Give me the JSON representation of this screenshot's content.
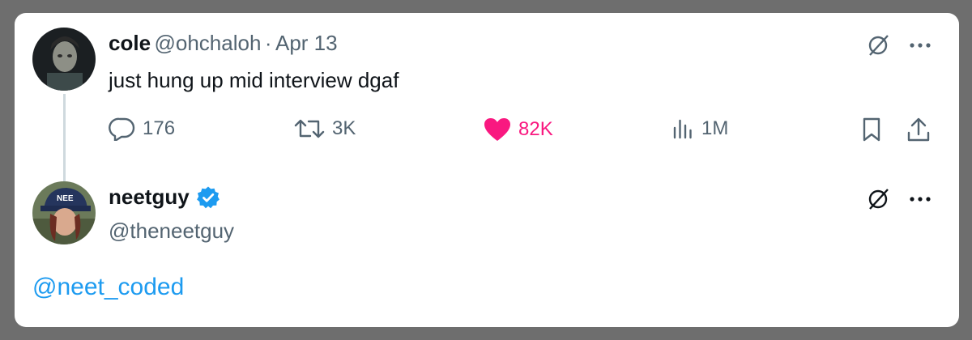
{
  "tweet": {
    "author_name": "cole",
    "author_handle": "@ohchaloh",
    "separator": "·",
    "date": "Apr 13",
    "text": "just hung up mid interview dgaf",
    "replies": "176",
    "retweets": "3K",
    "likes": "82K",
    "views": "1M",
    "liked": true
  },
  "reply": {
    "author_name": "neetguy",
    "author_handle": "@theneetguy",
    "verified": true,
    "text": "@neet_coded"
  },
  "icons": {
    "grok": "grok-icon",
    "more": "more-icon",
    "reply": "reply-icon",
    "retweet": "retweet-icon",
    "like": "heart-icon",
    "views": "views-icon",
    "bookmark": "bookmark-icon",
    "share": "share-icon",
    "verified": "verified-badge-icon"
  },
  "colors": {
    "like": "#f91880",
    "link": "#1d9bf0",
    "verified": "#1d9bf0",
    "muted": "#536471",
    "text": "#0f1419"
  }
}
